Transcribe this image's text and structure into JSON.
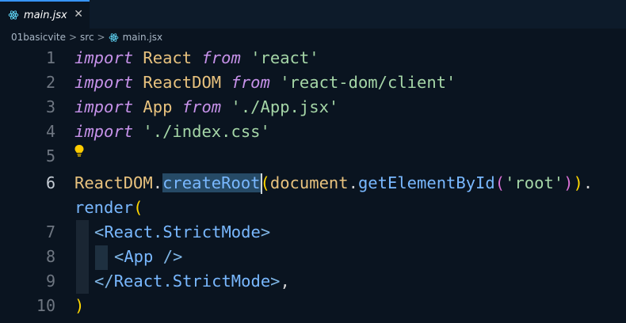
{
  "tab": {
    "label": "main.jsx",
    "close": "✕",
    "icon": "react-icon"
  },
  "breadcrumb": {
    "items": [
      "01basicvite",
      "src",
      "main.jsx"
    ],
    "separator": ">"
  },
  "lines": [
    {
      "n": "1"
    },
    {
      "n": "2"
    },
    {
      "n": "3"
    },
    {
      "n": "4"
    },
    {
      "n": "5"
    },
    {
      "n": "6"
    },
    {
      "n": ""
    },
    {
      "n": "7"
    },
    {
      "n": "8"
    },
    {
      "n": "9"
    },
    {
      "n": "10"
    }
  ],
  "tokens": {
    "import": "import",
    "from": "from",
    "react_id": "React",
    "react_str": "'react'",
    "reactdom_id": "ReactDOM",
    "reactdom_str": "'react-dom/client'",
    "app_id": "App",
    "app_str": "'./App.jsx'",
    "css_str": "'./index.css'",
    "dot": ".",
    "create_root": "createRoot",
    "open_paren": "(",
    "document": "document",
    "get_by_id": "getElementById",
    "root_str": "'root'",
    "close_paren": ")",
    "render": "render",
    "lt": "<",
    "lt_slash": "</",
    "gt": ">",
    "self_close": " />",
    "react_strict": "React.StrictMode",
    "app_tag": "App",
    "comma": ","
  },
  "colors": {
    "accent": "#3794ff",
    "background": "#0a1420",
    "keyword": "#c792ea",
    "string": "#a5d6a7"
  }
}
